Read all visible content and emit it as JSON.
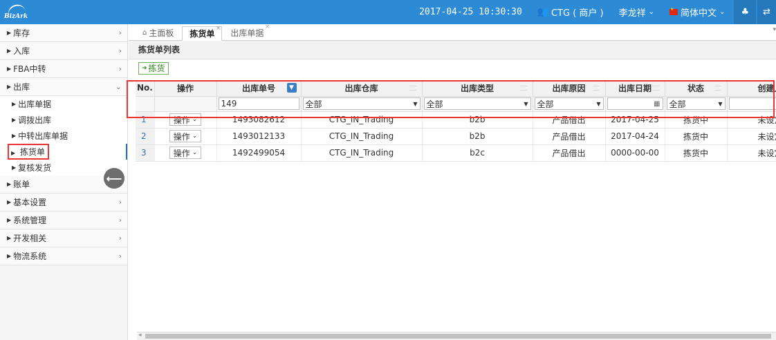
{
  "header": {
    "logo_text": "BizArk",
    "datetime": "2017-04-25 10:30:30",
    "account": "CTG ( 商户 )",
    "user": "李龙祥",
    "language": "简体中文"
  },
  "sidebar": {
    "items": [
      {
        "label": "库存"
      },
      {
        "label": "入库"
      },
      {
        "label": "FBA中转"
      },
      {
        "label": "出库"
      },
      {
        "label": "账单"
      },
      {
        "label": "基本设置"
      },
      {
        "label": "系统管理"
      },
      {
        "label": "开发相关"
      },
      {
        "label": "物流系统"
      }
    ],
    "outbound_subitems": [
      {
        "label": "出库单据"
      },
      {
        "label": "调拨出库"
      },
      {
        "label": "中转出库单据"
      },
      {
        "label": "拣货单"
      },
      {
        "label": "复核发货"
      }
    ]
  },
  "tabs": [
    {
      "label": "主面板"
    },
    {
      "label": "拣货单"
    },
    {
      "label": "出库单据"
    }
  ],
  "panel": {
    "title": "拣货单列表",
    "pick_button": "拣货"
  },
  "table": {
    "columns": [
      "No.",
      "操作",
      "出库单号",
      "出库仓库",
      "出库类型",
      "出库原因",
      "出库日期",
      "状态",
      "创建人"
    ],
    "filters": {
      "order_no": "149",
      "warehouse": "全部",
      "type": "全部",
      "reason": "全部",
      "status": "全部"
    },
    "op_label": "操作",
    "rows": [
      {
        "no": "1",
        "order_no": "1493082612",
        "warehouse": "CTG_IN_Trading",
        "type": "b2b",
        "reason": "产品借出",
        "date": "2017-04-25",
        "status": "拣货中",
        "creator": "未设定"
      },
      {
        "no": "2",
        "order_no": "1493012133",
        "warehouse": "CTG_IN_Trading",
        "type": "b2b",
        "reason": "产品借出",
        "date": "2017-04-24",
        "status": "拣货中",
        "creator": "未设定"
      },
      {
        "no": "3",
        "order_no": "1492499054",
        "warehouse": "CTG_IN_Trading",
        "type": "b2c",
        "reason": "产品借出",
        "date": "0000-00-00",
        "status": "拣货中",
        "creator": "未设定"
      }
    ]
  }
}
